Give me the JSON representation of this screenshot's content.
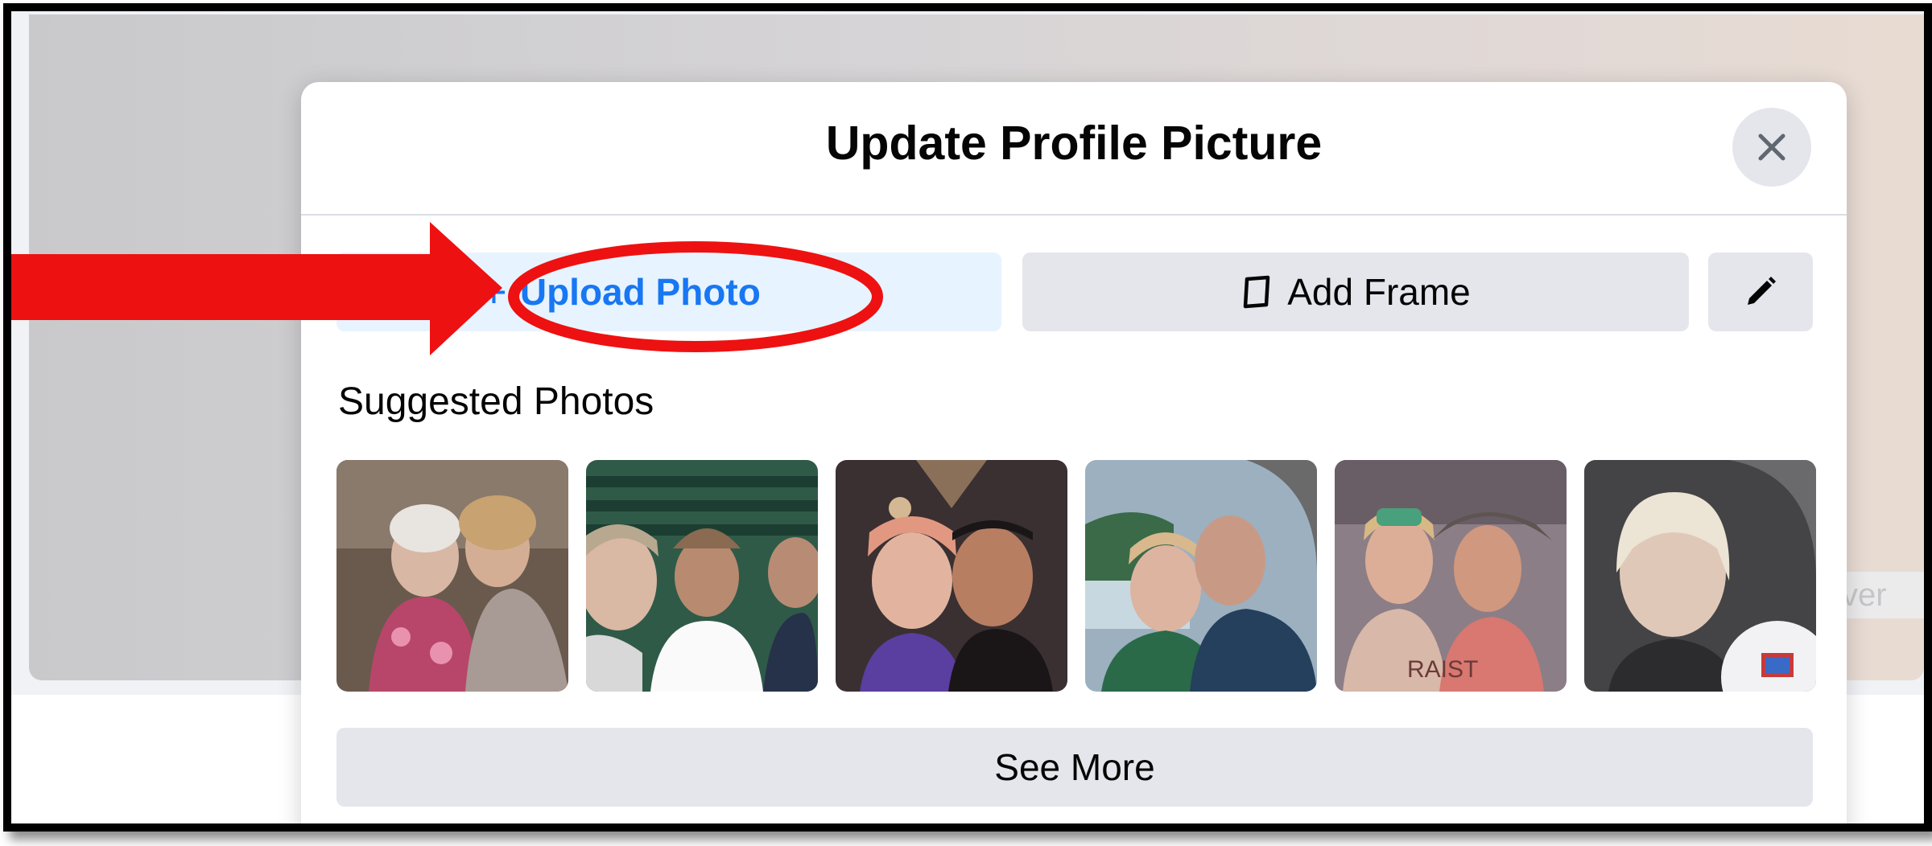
{
  "modal": {
    "title": "Update Profile Picture",
    "upload_label": "Upload Photo",
    "add_frame_label": "Add Frame",
    "suggested_title": "Suggested Photos",
    "see_more_label": "See More"
  },
  "background": {
    "edit_cover_partial": "ver"
  },
  "photos": [
    {
      "name": "photo-two-women-seated",
      "colors": [
        "#6a5a4e",
        "#b8869a",
        "#d4b8a4",
        "#3d3a38"
      ]
    },
    {
      "name": "photo-group-selfie-stadium",
      "colors": [
        "#2f5a48",
        "#c9b8a8",
        "#ffffff",
        "#1c2e28"
      ]
    },
    {
      "name": "photo-couple-selfie-concert",
      "colors": [
        "#3a3032",
        "#c8a28c",
        "#5a3ea0",
        "#1a1618"
      ]
    },
    {
      "name": "photo-couple-selfie-lake",
      "colors": [
        "#7d8fa0",
        "#c6a890",
        "#2a6040",
        "#24405c"
      ]
    },
    {
      "name": "photo-two-women-outdoor",
      "colors": [
        "#8c7e86",
        "#d6a694",
        "#d87870",
        "#4e4442"
      ]
    },
    {
      "name": "photo-woman-car-selfie",
      "colors": [
        "#444446",
        "#e4d4c8",
        "#2c2c2e",
        "#f2f2f4"
      ]
    }
  ],
  "annotation": {
    "arrow_color": "#ee1111",
    "ellipse_color": "#ee1111"
  },
  "colors": {
    "accent": "#1877f2",
    "accent_bg": "#e7f3ff",
    "button_bg": "#e4e6eb",
    "text": "#050505"
  }
}
